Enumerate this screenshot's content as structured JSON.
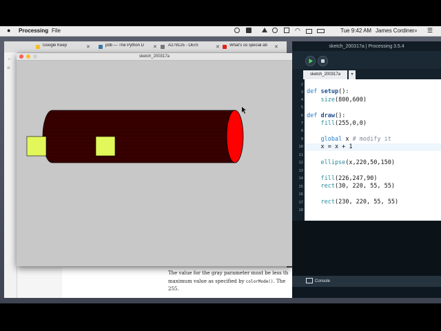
{
  "menubar": {
    "app_name": "Processing",
    "menu_file": "File",
    "time": "Tue 9:42 AM",
    "user": "James Cordiner"
  },
  "browser": {
    "tabs": [
      {
        "label": "Google Keep",
        "fav_color": "#f6c026"
      },
      {
        "label": "pdb — The Python D",
        "fav_color": "#3b77a8"
      },
      {
        "label": "A279125 - OEIS",
        "fav_color": "#777777"
      },
      {
        "label": "What's so special ab",
        "fav_color": "#e62117"
      }
    ],
    "doc_line1": "The value for the gray parameter must be less th",
    "doc_line2_a": "maximum value as specified by ",
    "doc_line2_code": "colorMode()",
    "doc_line2_b": ". The",
    "doc_line3": "255."
  },
  "sketch_window": {
    "title": "sketch_200317a"
  },
  "ide": {
    "title": "sketch_200317a | Processing 3.5.4",
    "tab_label": "sketch_200317a",
    "tab_arrow": "▾",
    "console_label": "Console",
    "line_numbers": [
      "2",
      "3",
      "4",
      "5",
      "6",
      "7",
      "8",
      "9",
      "10",
      "11",
      "12",
      "13",
      "14",
      "15",
      "16",
      "17",
      "18"
    ],
    "code": [
      {
        "line": "2",
        "text": ""
      },
      {
        "line": "3",
        "text": "def setup():"
      },
      {
        "line": "4",
        "text": "    size(800,600)"
      },
      {
        "line": "5",
        "text": ""
      },
      {
        "line": "6",
        "text": "def draw():"
      },
      {
        "line": "7",
        "text": "    fill(255,0,0)"
      },
      {
        "line": "8",
        "text": ""
      },
      {
        "line": "9",
        "text": "    global x # modify it"
      },
      {
        "line": "10",
        "text": "    x = x + 1"
      },
      {
        "line": "11",
        "text": ""
      },
      {
        "line": "12",
        "text": "    ellipse(x,220,50,150)"
      },
      {
        "line": "13",
        "text": ""
      },
      {
        "line": "14",
        "text": "    fill(226,247,90)"
      },
      {
        "line": "15",
        "text": "    rect(30, 220, 55, 55)"
      },
      {
        "line": "16",
        "text": ""
      },
      {
        "line": "17",
        "text": "    rect(230, 220, 55, 55)"
      },
      {
        "line": "18",
        "text": ""
      }
    ]
  },
  "colors": {
    "cylinder_body": "#4a0000",
    "cylinder_end": "#ff0000",
    "rect_fill": "#e2f75a",
    "canvas_bg": "#c8c8c8",
    "ide_dark": "#111c24",
    "run_green": "#4cd964"
  }
}
